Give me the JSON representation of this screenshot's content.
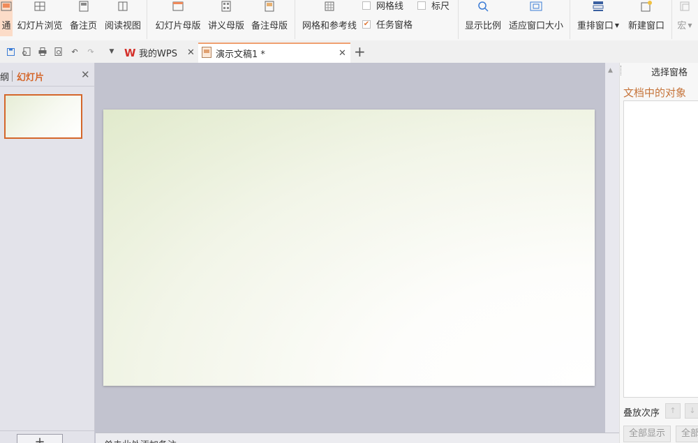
{
  "ribbon": {
    "buttons": [
      {
        "id": "normal",
        "label": "通",
        "icon": "normal-view-icon"
      },
      {
        "id": "slide-sorter",
        "label": "幻灯片浏览",
        "icon": "slide-sorter-icon"
      },
      {
        "id": "notes-page",
        "label": "备注页",
        "icon": "notes-page-icon"
      },
      {
        "id": "reading-view",
        "label": "阅读视图",
        "icon": "reading-view-icon"
      },
      {
        "id": "slide-master",
        "label": "幻灯片母版",
        "icon": "slide-master-icon"
      },
      {
        "id": "handout-master",
        "label": "讲义母版",
        "icon": "handout-master-icon"
      },
      {
        "id": "notes-master",
        "label": "备注母版",
        "icon": "notes-master-icon"
      },
      {
        "id": "grid-guides",
        "label": "网格和参考线",
        "icon": "grid-icon"
      },
      {
        "id": "zoom",
        "label": "显示比例",
        "icon": "magnifier-icon"
      },
      {
        "id": "fit-window",
        "label": "适应窗口大小",
        "icon": "fit-window-icon"
      },
      {
        "id": "arrange",
        "label": "重排窗口",
        "icon": "arrange-window-icon"
      },
      {
        "id": "new-window",
        "label": "新建窗口",
        "icon": "new-window-icon"
      },
      {
        "id": "macro",
        "label": "宏",
        "icon": "macro-icon"
      }
    ],
    "checks": {
      "gridlines": {
        "label": "网格线",
        "checked": false
      },
      "ruler": {
        "label": "标尺",
        "checked": false
      },
      "task_pane": {
        "label": "任务窗格",
        "checked": true
      }
    }
  },
  "tabs": [
    {
      "label": "我的WPS",
      "icon": "wps-logo-icon",
      "active": false
    },
    {
      "label": "演示文稿1 *",
      "icon": "presentation-doc-icon",
      "active": true
    }
  ],
  "left_panel": {
    "outline_tab": "纲",
    "slides_tab": "幻灯片"
  },
  "notes_placeholder": "单击此处添加备注",
  "right_panel": {
    "title": "选择窗格",
    "subtitle": "文档中的对象",
    "order_label": "叠放次序",
    "show_all": "全部显示",
    "hide_all": "全部"
  },
  "colors": {
    "accent": "#d4662a",
    "ribbon_bg": "#f7f7f7",
    "canvas_bg": "#c2c3cf"
  }
}
